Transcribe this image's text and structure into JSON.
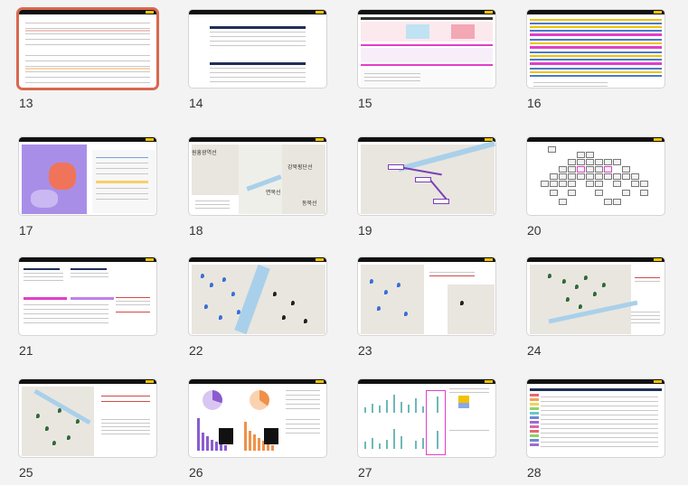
{
  "slides": [
    {
      "num": "13",
      "selected": true
    },
    {
      "num": "14"
    },
    {
      "num": "15"
    },
    {
      "num": "16"
    },
    {
      "num": "17"
    },
    {
      "num": "18",
      "labels": [
        "원흥광역선",
        "강북횡단선",
        "면목선",
        "동북선"
      ]
    },
    {
      "num": "19"
    },
    {
      "num": "20"
    },
    {
      "num": "21"
    },
    {
      "num": "22"
    },
    {
      "num": "23"
    },
    {
      "num": "24"
    },
    {
      "num": "25"
    },
    {
      "num": "26"
    },
    {
      "num": "27"
    },
    {
      "num": "28"
    }
  ],
  "colors": {
    "selection": "#d9684f",
    "slide_header": "#111111",
    "logo": "#f2c200",
    "magenta": "#e040c8",
    "map": "#e9e6df",
    "river": "#a9d0ea"
  }
}
